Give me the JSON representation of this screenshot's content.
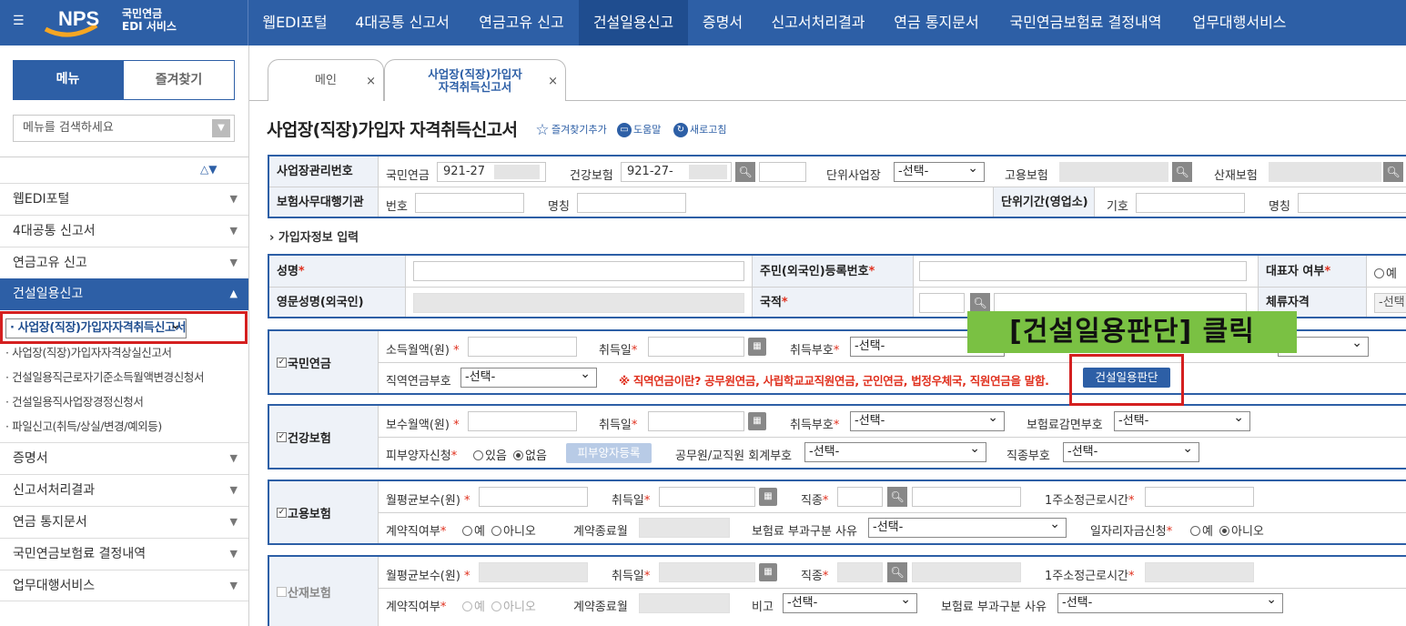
{
  "header": {
    "logo_text": "NPS",
    "logo_sub1": "국민연금",
    "logo_sub2": "EDI 서비스",
    "nav": [
      "웹EDI포털",
      "4대공통 신고서",
      "연금고유 신고",
      "건설일용신고",
      "증명서",
      "신고서처리결과",
      "연금 통지문서",
      "국민연금보험료 결정내역",
      "업무대행서비스"
    ],
    "active_nav": "건설일용신고"
  },
  "sidebar": {
    "tab_menu": "메뉴",
    "tab_favorites": "즐겨찾기",
    "search_placeholder": "메뉴를 검색하세요",
    "items": [
      "웹EDI포털",
      "4대공통 신고서",
      "연금고유 신고",
      "건설일용신고"
    ],
    "sub_items": [
      "사업장(직장)가입자자격취득신고서",
      "사업장(직장)가입자자격상실신고서",
      "건설일용직근로자기준소득월액변경신청서",
      "건설일용직사업장경정신청서",
      "파일신고(취득/상실/변경/예외등)"
    ],
    "items_after": [
      "증명서",
      "신고서처리결과",
      "연금 통지문서",
      "국민연금보험료 결정내역",
      "업무대행서비스"
    ]
  },
  "tabs": {
    "main": "메인",
    "active_line1": "사업장(직장)가입자",
    "active_line2": "자격취득신고서",
    "close": "×"
  },
  "page": {
    "title": "사업장(직장)가입자 자격취득신고서",
    "favorite": "즐겨찾기추가",
    "help": "도움말",
    "refresh": "새로고침"
  },
  "workplace": {
    "mgmt_no_label": "사업장관리번호",
    "pension_label": "국민연금",
    "pension_value": "921-27",
    "health_label": "건강보험",
    "health_value": "921-27-",
    "unit_label": "단위사업장",
    "unit_select": "-선택-",
    "employ_label": "고용보험",
    "industrial_label": "산재보험",
    "agency_label": "보험사무대행기관",
    "number_label": "번호",
    "name_label": "명칭",
    "unit_period_label": "단위기간(영업소)",
    "symbol_label": "기호",
    "name2_label": "명칭"
  },
  "subscriber": {
    "section": "› 가입자정보 입력",
    "name_label": "성명",
    "rrn_label": "주민(외국인)등록번호",
    "rep_label": "대표자 여부",
    "rep_option": "예",
    "eng_name_label": "영문성명(외국인)",
    "nationality_label": "국적",
    "stay_label": "체류자격",
    "stay_select": "-선택"
  },
  "pension": {
    "header": "국민연금",
    "income_label": "소득월액(원)",
    "acq_date_label": "취득일",
    "acq_code_label": "취득부호",
    "acq_code_select": "-선택-",
    "job_pension_label": "직역연금부호",
    "job_pension_select": "-선택-",
    "notice": "※ 직역연금이란? 공무원연금, 사립학교교직원연금, 군인연금, 법정우체국, 직원연금을 말함.",
    "judge_button": "건설일용판단"
  },
  "health": {
    "header": "건강보험",
    "pay_label": "보수월액(원)",
    "acq_date_label": "취득일",
    "acq_code_label": "취득부호",
    "acq_code_select": "-선택-",
    "reduce_label": "보험료감면부호",
    "reduce_select": "-선택-",
    "dependent_label": "피부양자신청",
    "opt_yes": "있음",
    "opt_no": "없음",
    "dependent_button": "피부양자등록",
    "gov_label": "공무원/교직원 회계부호",
    "gov_select": "-선택-",
    "job_type_label": "직종부호",
    "job_type_select": "-선택-"
  },
  "employment": {
    "header": "고용보험",
    "avg_pay_label": "월평균보수(원)",
    "acq_date_label": "취득일",
    "job_label": "직종",
    "weekly_hours_label": "1주소정근로시간",
    "contract_label": "계약직여부",
    "opt_yes": "예",
    "opt_no": "아니오",
    "contract_end_label": "계약종료월",
    "levy_reason_label": "보험료 부과구분 사유",
    "levy_select": "-선택-",
    "job_fund_label": "일자리자금신청",
    "fund_yes": "예",
    "fund_no": "아니오"
  },
  "industrial": {
    "header": "산재보험",
    "avg_pay_label": "월평균보수(원)",
    "acq_date_label": "취득일",
    "job_label": "직종",
    "weekly_hours_label": "1주소정근로시간",
    "contract_label": "계약직여부",
    "opt_yes": "예",
    "opt_no": "아니오",
    "contract_end_label": "계약종료월",
    "note_label": "비고",
    "note_select": "-선택-",
    "levy_reason_label": "보험료 부과구분 사유",
    "levy_select": "-선택-"
  },
  "annotation": {
    "text": "[건설일용판단] 클릭"
  },
  "colors": {
    "brand": "#2d5fa6",
    "highlight": "#d42020",
    "annotation_bg": "#7ac143",
    "notice": "#e0301e"
  }
}
